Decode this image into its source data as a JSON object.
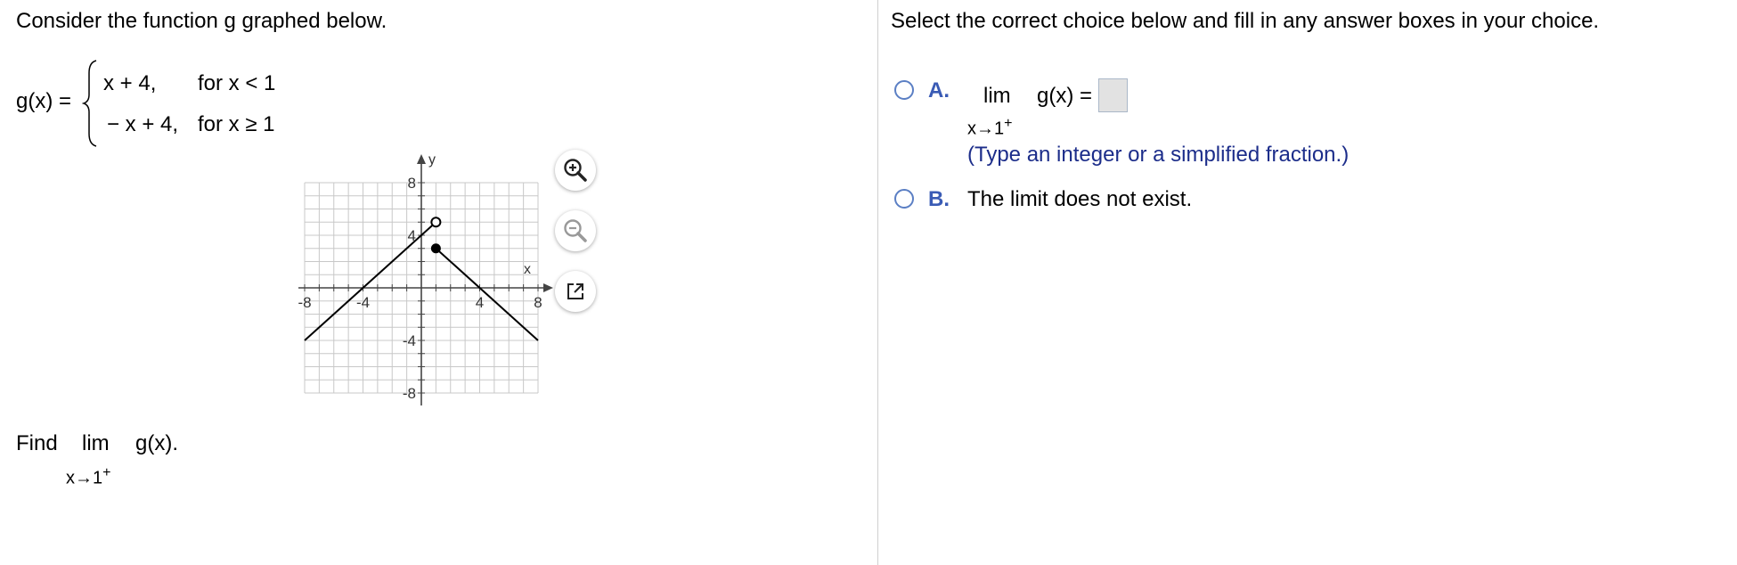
{
  "question": {
    "intro": "Consider the function g graphed below.",
    "function_name": "g(x) =",
    "piece1_expr": "x + 4,",
    "piece1_cond": "for x < 1",
    "piece2_expr": "− x + 4,",
    "piece2_cond": "for x ≥ 1",
    "find_prefix": "Find",
    "find_lim": "lim",
    "find_func": "g(x).",
    "find_sub": "x→1",
    "find_sup": "+"
  },
  "graph": {
    "x_axis_label": "x",
    "y_axis_label": "y",
    "x_ticks": [
      "-8",
      "-4",
      "4",
      "8"
    ],
    "y_ticks": [
      "8",
      "4",
      "-4",
      "-8"
    ],
    "xlim": [
      -8,
      8
    ],
    "ylim": [
      -8,
      8
    ],
    "lines": [
      {
        "from": [
          -8,
          -4
        ],
        "to": [
          1,
          5
        ]
      },
      {
        "from": [
          1,
          3
        ],
        "to": [
          8,
          -4
        ]
      }
    ],
    "open_point": [
      1,
      5
    ],
    "closed_point": [
      1,
      3
    ]
  },
  "tools": {
    "zoom_in_icon": "zoom-in-icon",
    "zoom_out_icon": "zoom-out-icon",
    "popout_icon": "popout-icon"
  },
  "answer": {
    "instruction": "Select the correct choice below and fill in any answer boxes in your choice.",
    "choice_a_letter": "A.",
    "choice_a_lim": "lim",
    "choice_a_func": "g(x) =",
    "choice_a_sub": "x→1",
    "choice_a_sup": "+",
    "choice_a_hint": "(Type an integer or a simplified fraction.)",
    "choice_b_letter": "B.",
    "choice_b_text": "The limit does not exist."
  }
}
